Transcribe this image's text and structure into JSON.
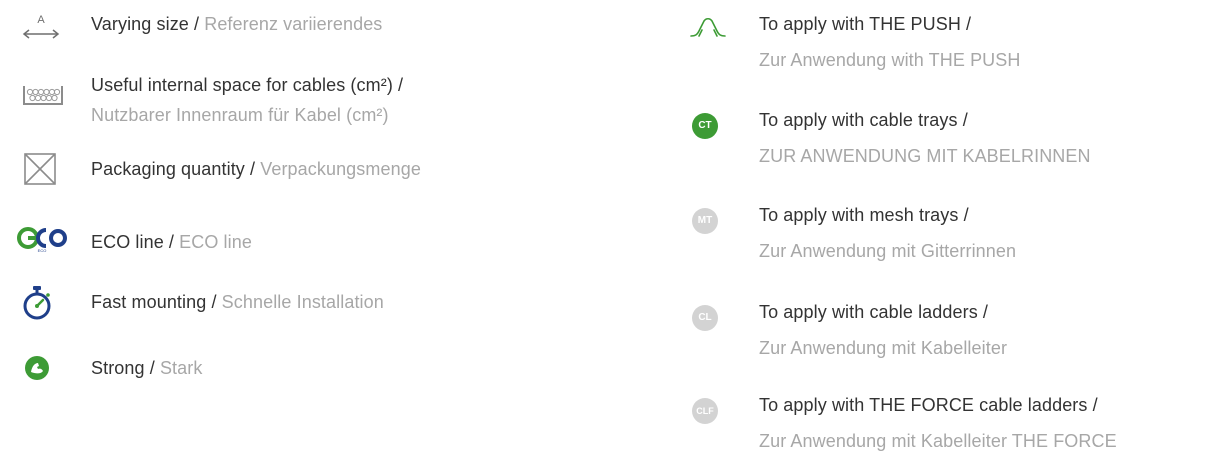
{
  "colors": {
    "text_primary": "#333333",
    "text_secondary": "#a7a7a7",
    "green": "#3d9b35",
    "gray_badge": "#d3d3d3",
    "eco_blue": "#1f3f8a",
    "icon_gray": "#8c8c8c"
  },
  "left": [
    {
      "icon": "varying-size-icon",
      "en": "Varying size",
      "sep": " / ",
      "de": "Referenz variierendes"
    },
    {
      "icon": "internal-space-icon",
      "en": "Useful internal space for cables (cm²) /",
      "de": "Nutzbarer Innenraum für Kabel (cm²)"
    },
    {
      "icon": "packaging-box-icon",
      "en": "Packaging quantity",
      "sep": " / ",
      "de": "Verpackungsmenge"
    },
    {
      "icon": "eco-line-icon",
      "en": "ECO line",
      "sep": " / ",
      "de": "ECO line"
    },
    {
      "icon": "stopwatch-icon",
      "en": "Fast mounting",
      "sep": " / ",
      "de": "Schnelle Installation"
    },
    {
      "icon": "strong-arm-icon",
      "en": "Strong",
      "sep": " / ",
      "de": "Stark"
    }
  ],
  "right": [
    {
      "icon": "push-icon",
      "en": "To apply with THE PUSH /",
      "de": "Zur Anwendung with THE PUSH"
    },
    {
      "icon": "ct-badge-icon",
      "badge": "CT",
      "en": "To apply with cable trays /",
      "de": "ZUR ANWENDUNG MIT KABELRINNEN"
    },
    {
      "icon": "mt-badge-icon",
      "badge": "MT",
      "en": "To apply with mesh trays /",
      "de": "Zur Anwendung mit Gitterrinnen"
    },
    {
      "icon": "cl-badge-icon",
      "badge": "CL",
      "en": "To apply with cable ladders /",
      "de": "Zur Anwendung mit Kabelleiter"
    },
    {
      "icon": "clf-badge-icon",
      "badge": "CLF",
      "en": "To apply with THE FORCE cable ladders /",
      "de": "Zur Anwendung mit Kabelleiter THE FORCE"
    }
  ],
  "eco_logo_text": "ECO"
}
